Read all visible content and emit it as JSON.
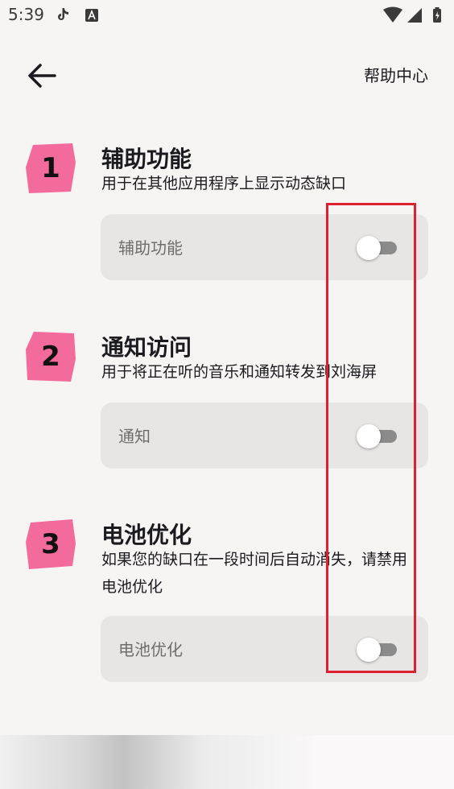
{
  "status_bar": {
    "time": "5:39"
  },
  "header": {
    "help_label": "帮助中心"
  },
  "sections": [
    {
      "number": "1",
      "title": "辅助功能",
      "description": "用于在其他应用程序上显示动态缺口",
      "setting_label": "辅助功能",
      "enabled": false
    },
    {
      "number": "2",
      "title": "通知访问",
      "description": "用于将正在听的音乐和通知转发到刘海屏",
      "setting_label": "通知",
      "enabled": false
    },
    {
      "number": "3",
      "title": "电池优化",
      "description": "如果您的缺口在一段时间后自动消失，请禁用电池优化",
      "setting_label": "电池优化",
      "enabled": false
    }
  ],
  "colors": {
    "badge": "#f36a9d",
    "annotation": "#e02030",
    "card": "#e8e6e5",
    "background": "#f7f5f4"
  }
}
